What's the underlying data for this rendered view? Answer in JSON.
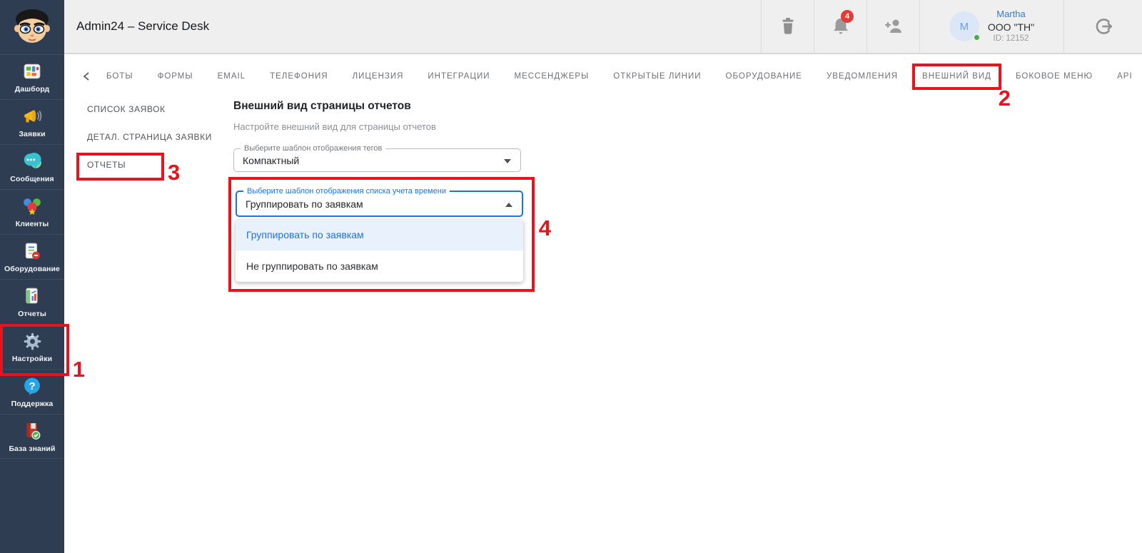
{
  "annotations": {
    "steps": [
      "1",
      "2",
      "3",
      "4"
    ],
    "color": "#e9121d"
  },
  "header": {
    "title": "Admin24 – Service Desk",
    "notifications_count": "4",
    "user": {
      "avatar_initial": "M",
      "name": "Martha",
      "company": "OOO \"TH\"",
      "id": "ID: 12152"
    }
  },
  "sidebar": {
    "items": [
      {
        "label": "Дашборд"
      },
      {
        "label": "Заявки"
      },
      {
        "label": "Сообщения"
      },
      {
        "label": "Клиенты"
      },
      {
        "label": "Оборудование"
      },
      {
        "label": "Отчеты"
      },
      {
        "label": "Настройки"
      },
      {
        "label": "Поддержка"
      },
      {
        "label": "База знаний"
      }
    ]
  },
  "tabs": {
    "items": [
      "БОТЫ",
      "ФОРМЫ",
      "EMAIL",
      "ТЕЛЕФОНИЯ",
      "ЛИЦЕНЗИЯ",
      "ИНТЕГРАЦИИ",
      "МЕССЕНДЖЕРЫ",
      "ОТКРЫТЫЕ ЛИНИИ",
      "ОБОРУДОВАНИЕ",
      "УВЕДОМЛЕНИЯ",
      "ВНЕШНИЙ ВИД",
      "БОКОВОЕ МЕНЮ",
      "API"
    ]
  },
  "submenu": {
    "items": [
      "СПИСОК ЗАЯВОК",
      "ДЕТАЛ. СТРАНИЦА ЗАЯВКИ",
      "ОТЧЕТЫ"
    ]
  },
  "content": {
    "title": "Внешний вид страницы отчетов",
    "subtitle": "Настройте внешний вид для страницы отчетов",
    "select_tags": {
      "label": "Выберите шаблон отображения тегов",
      "value": "Компактный"
    },
    "select_time": {
      "label": "Выберите шаблон отображения списка учета времени",
      "value": "Группировать по заявкам",
      "options": [
        {
          "label": "Группировать по заявкам",
          "selected": true
        },
        {
          "label": "Не группировать по заявкам",
          "selected": false
        }
      ]
    }
  }
}
